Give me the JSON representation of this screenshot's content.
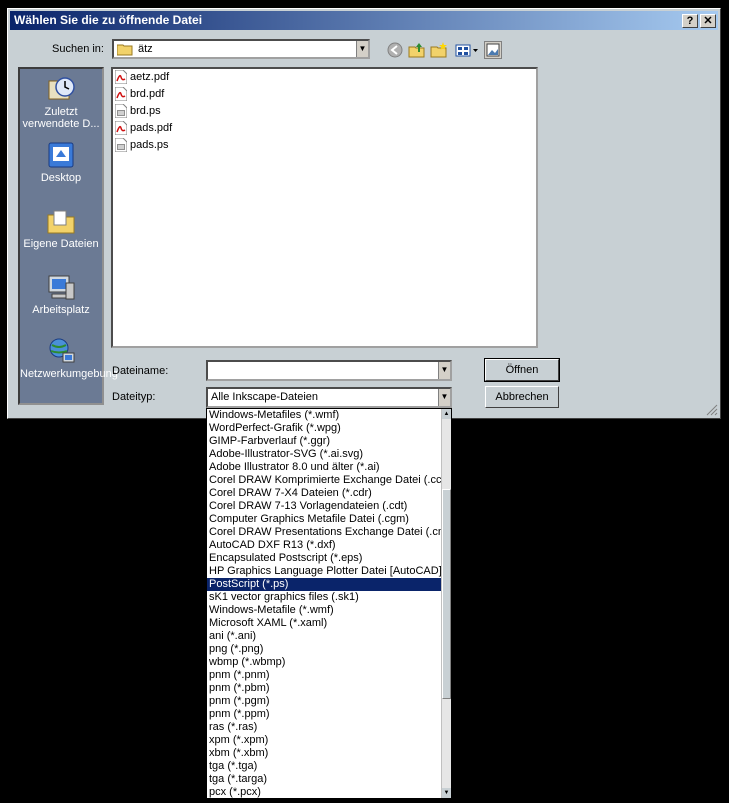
{
  "dialog": {
    "title": "Wählen Sie die zu öffnende Datei",
    "help_label": "?",
    "close_label": "✕"
  },
  "lookin": {
    "label": "Suchen in:",
    "value": "ätz"
  },
  "places": [
    {
      "label": "Zuletzt verwendete D..."
    },
    {
      "label": "Desktop"
    },
    {
      "label": "Eigene Dateien"
    },
    {
      "label": "Arbeitsplatz"
    },
    {
      "label": "Netzwerkumgebung"
    }
  ],
  "files": [
    {
      "name": "aetz.pdf",
      "icon": "pdf-icon"
    },
    {
      "name": "brd.pdf",
      "icon": "pdf-icon"
    },
    {
      "name": "brd.ps",
      "icon": "ps-icon"
    },
    {
      "name": "pads.pdf",
      "icon": "pdf-icon"
    },
    {
      "name": "pads.ps",
      "icon": "ps-icon"
    }
  ],
  "filename": {
    "label": "Dateiname:",
    "value": ""
  },
  "filetype": {
    "label": "Dateityp:",
    "value": "Alle Inkscape-Dateien"
  },
  "buttons": {
    "open": "Öffnen",
    "cancel": "Abbrechen"
  },
  "filetype_options": [
    "Windows-Metafiles (*.wmf)",
    "WordPerfect-Grafik (*.wpg)",
    "GIMP-Farbverlauf (*.ggr)",
    "Adobe-Illustrator-SVG (*.ai.svg)",
    "Adobe Illustrator 8.0 und älter (*.ai)",
    "Corel DRAW Komprimierte Exchange Datei (.ccx)",
    "Corel DRAW 7-X4 Dateien (*.cdr)",
    "Corel DRAW 7-13 Vorlagendateien (.cdt)",
    "Computer Graphics Metafile Datei (.cgm)",
    "Corel DRAW Presentations Exchange Datei (.cmx)",
    "AutoCAD DXF R13 (*.dxf)",
    "Encapsulated Postscript (*.eps)",
    "HP Graphics Language Plotter Datei [AutoCAD] (*.plt)",
    "PostScript (*.ps)",
    "sK1 vector graphics files (.sk1)",
    "Windows-Metafile (*.wmf)",
    "Microsoft XAML (*.xaml)",
    "ani (*.ani)",
    "png (*.png)",
    "wbmp (*.wbmp)",
    "pnm (*.pnm)",
    "pnm (*.pbm)",
    "pnm (*.pgm)",
    "pnm (*.ppm)",
    "ras (*.ras)",
    "xpm (*.xpm)",
    "xbm (*.xbm)",
    "tga (*.tga)",
    "tga (*.targa)",
    "pcx (*.pcx)"
  ],
  "selected_option_index": 13
}
